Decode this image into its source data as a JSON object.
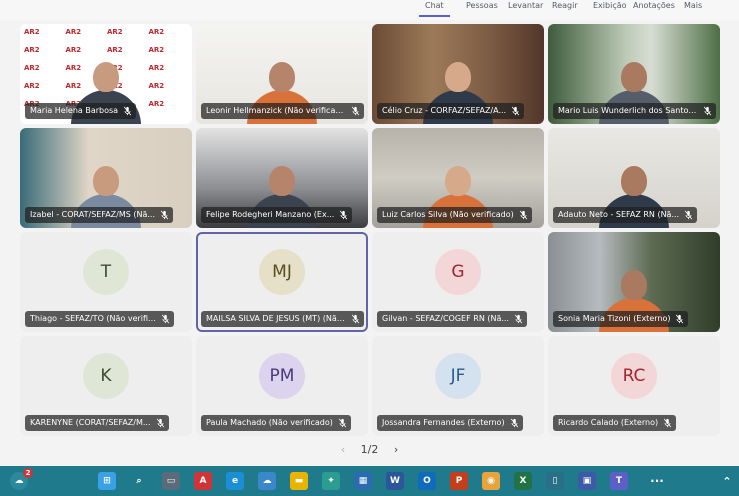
{
  "toolbar": {
    "tabs": [
      {
        "label": "Chat",
        "active": true
      },
      {
        "label": "Pessoas"
      },
      {
        "label": "Levantar"
      },
      {
        "label": "Reagir"
      },
      {
        "label": "Exibição"
      },
      {
        "label": "Anotações"
      },
      {
        "label": "Mais"
      }
    ]
  },
  "participants": [
    {
      "name": "Maria Helena Barbosa",
      "video": "logo"
    },
    {
      "name": "Leonir Hellmanzick (Não verificado)",
      "video": "office"
    },
    {
      "name": "Célio Cruz - CORFAZ/SEFAZ/A...",
      "video": "books"
    },
    {
      "name": "Mario Luis Wunderlich dos Santos ...",
      "video": "plant"
    },
    {
      "name": "Izabel - CORAT/SEFAZ/MS (Nã...",
      "video": "warm"
    },
    {
      "name": "Felipe Rodegheri Manzano (Ex...",
      "video": "openoffice"
    },
    {
      "name": "Luiz Carlos Silva (Não verificado)",
      "video": "dim"
    },
    {
      "name": "Adauto Neto - SEFAZ RN (Nã...",
      "video": "light"
    },
    {
      "name": "Thiago - SEFAZ/TO (Não verifi...",
      "initials": "T",
      "avatar_color": "#dfe6d6",
      "text_color": "#3d4a33"
    },
    {
      "name": "MAILSA SILVA DE JESUS (MT) (Não...",
      "initials": "MJ",
      "avatar_color": "#e6e0c8",
      "text_color": "#5a4d1f",
      "selected": true
    },
    {
      "name": "Gilvan - SEFAZ/COGEF RN (Nã...",
      "initials": "G",
      "avatar_color": "#f3d6d8",
      "text_color": "#a3262f"
    },
    {
      "name": "Sonia Maria Tizoni (Externo)",
      "video": "volcano"
    },
    {
      "name": "KARENYNE (CORAT/SEFAZ/M...",
      "initials": "K",
      "avatar_color": "#dfe6d6",
      "text_color": "#3d4a33"
    },
    {
      "name": "Paula Machado (Não verificado)",
      "initials": "PM",
      "avatar_color": "#dcd3ee",
      "text_color": "#4a3a7a"
    },
    {
      "name": "Jossandra Fernandes (Externo)",
      "initials": "JF",
      "avatar_color": "#d4e2f0",
      "text_color": "#2b5a8a"
    },
    {
      "name": "Ricardo Calado (Externo)",
      "initials": "RC",
      "avatar_color": "#f3d6d8",
      "text_color": "#a3262f"
    }
  ],
  "logo_text": "AR2",
  "pager": {
    "prev": "‹",
    "label": "1/2",
    "next": "›"
  },
  "taskbar": {
    "notification_count": "2",
    "teams_badge": "",
    "more_label": "···",
    "icons": [
      {
        "name": "start-icon",
        "glyph": "⊞",
        "color": "#3aa0e8"
      },
      {
        "name": "search-icon",
        "glyph": "⌕",
        "color": "#1f7a8c"
      },
      {
        "name": "task-view-icon",
        "glyph": "▭",
        "color": "#5a6b7a"
      },
      {
        "name": "pdf-icon",
        "glyph": "A",
        "color": "#d13438"
      },
      {
        "name": "edge-icon",
        "glyph": "e",
        "color": "#1b8fd6"
      },
      {
        "name": "weather-icon",
        "glyph": "☁",
        "color": "#3a87c9"
      },
      {
        "name": "file-explorer-icon",
        "glyph": "▬",
        "color": "#e8b400"
      },
      {
        "name": "app-icon",
        "glyph": "✦",
        "color": "#2a9d8f"
      },
      {
        "name": "calendar-icon",
        "glyph": "▦",
        "color": "#2b6cb0"
      },
      {
        "name": "word-icon",
        "glyph": "W",
        "color": "#2b579a"
      },
      {
        "name": "outlook-icon",
        "glyph": "O",
        "color": "#0f6cbd"
      },
      {
        "name": "powerpoint-icon",
        "glyph": "P",
        "color": "#c43e1c"
      },
      {
        "name": "chrome-icon",
        "glyph": "◉",
        "color": "#e8a33d"
      },
      {
        "name": "excel-icon",
        "glyph": "X",
        "color": "#217346"
      },
      {
        "name": "notes-icon",
        "glyph": "▯",
        "color": "#2a6f88"
      },
      {
        "name": "remote-icon",
        "glyph": "▣",
        "color": "#3d5aa8"
      },
      {
        "name": "teams-icon",
        "glyph": "T",
        "color": "#5b5fc7"
      }
    ]
  }
}
